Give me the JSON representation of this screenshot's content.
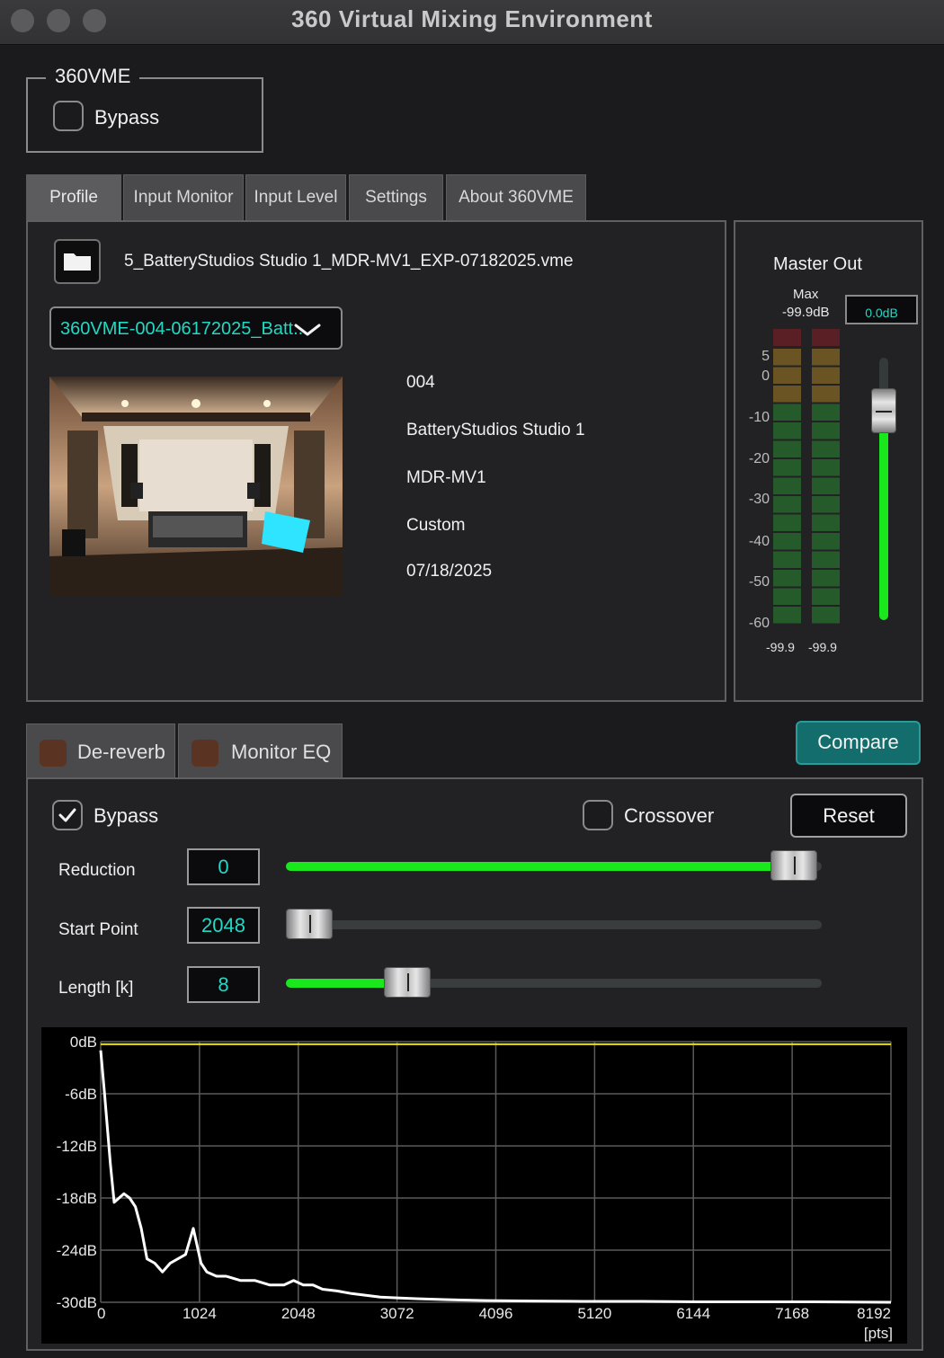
{
  "window": {
    "title": "360 Virtual Mixing Environment"
  },
  "group": {
    "legend": "360VME",
    "bypass_label": "Bypass",
    "bypass_checked": false
  },
  "tabs": [
    {
      "label": "Profile",
      "active": true
    },
    {
      "label": "Input Monitor",
      "active": false
    },
    {
      "label": "Input Level",
      "active": false
    },
    {
      "label": "Settings",
      "active": false
    },
    {
      "label": "About 360VME",
      "active": false
    }
  ],
  "profile": {
    "folder_icon": "folder-icon",
    "filename": "5_BatteryStudios Studio 1_MDR-MV1_EXP-07182025.vme",
    "dropdown_value": "360VME-004-06172025_Batt...",
    "info": [
      "004",
      "BatteryStudios Studio 1",
      "MDR-MV1",
      "Custom",
      "07/18/2025"
    ]
  },
  "master_out": {
    "title": "Master Out",
    "max_label": "Max",
    "max_value": "-99.9dB",
    "gain_value": "0.0dB",
    "scale": [
      "5",
      "0",
      "-10",
      "-20",
      "-30",
      "-40",
      "-50",
      "-60"
    ],
    "left_peak": "-99.9",
    "right_peak": "-99.9",
    "fader_fraction": 0.86
  },
  "effects": {
    "tabs": [
      {
        "label": "De-reverb",
        "swatch_color": "#5a3322"
      },
      {
        "label": "Monitor EQ",
        "swatch_color": "#5a3322"
      }
    ],
    "compare_label": "Compare",
    "bypass_label": "Bypass",
    "bypass_checked": true,
    "crossover_label": "Crossover",
    "crossover_checked": false,
    "reset_label": "Reset",
    "params": [
      {
        "label": "Reduction",
        "value": "0",
        "fraction": 0.99
      },
      {
        "label": "Start Point",
        "value": "2048",
        "fraction": 0.0
      },
      {
        "label": "Length [k]",
        "value": "8",
        "fraction": 0.2
      }
    ]
  },
  "chart_data": {
    "type": "line",
    "xlabel": "[pts]",
    "ylabel": "",
    "xlim": [
      0,
      8192
    ],
    "ylim": [
      -30,
      0
    ],
    "x_ticks": [
      "0",
      "1024",
      "2048",
      "3072",
      "4096",
      "5120",
      "6144",
      "7168",
      "8192"
    ],
    "y_ticks": [
      "0dB",
      "-6dB",
      "-12dB",
      "-18dB",
      "-24dB",
      "-30dB"
    ],
    "grid": true,
    "series": [
      {
        "color": "#ffffff",
        "x": [
          0,
          40,
          100,
          140,
          190,
          240,
          300,
          360,
          420,
          480,
          560,
          640,
          720,
          800,
          880,
          920,
          960,
          1000,
          1040,
          1100,
          1200,
          1300,
          1450,
          1600,
          1750,
          1900,
          2000,
          2100,
          2200,
          2300,
          2450,
          2600,
          2750,
          2900,
          3100,
          3300,
          3600,
          4000,
          4500,
          5000,
          5600,
          6200,
          6800,
          7400,
          8192
        ],
        "y": [
          -1,
          -6,
          -14,
          -18.5,
          -18,
          -17.5,
          -18,
          -19,
          -21.5,
          -25,
          -25.5,
          -26.5,
          -25.5,
          -25,
          -24.5,
          -23,
          -21.5,
          -23.5,
          -25.5,
          -26.5,
          -27,
          -27,
          -27.5,
          -27.5,
          -28,
          -28,
          -27.5,
          -28,
          -28,
          -28.5,
          -28.7,
          -29,
          -29.2,
          -29.4,
          -29.5,
          -29.6,
          -29.7,
          -29.8,
          -29.85,
          -29.9,
          -29.9,
          -29.95,
          -29.95,
          -29.95,
          -30
        ]
      },
      {
        "color": "#e8e600",
        "x": [
          0,
          8192
        ],
        "y": [
          -0.3,
          -0.3
        ]
      }
    ]
  }
}
